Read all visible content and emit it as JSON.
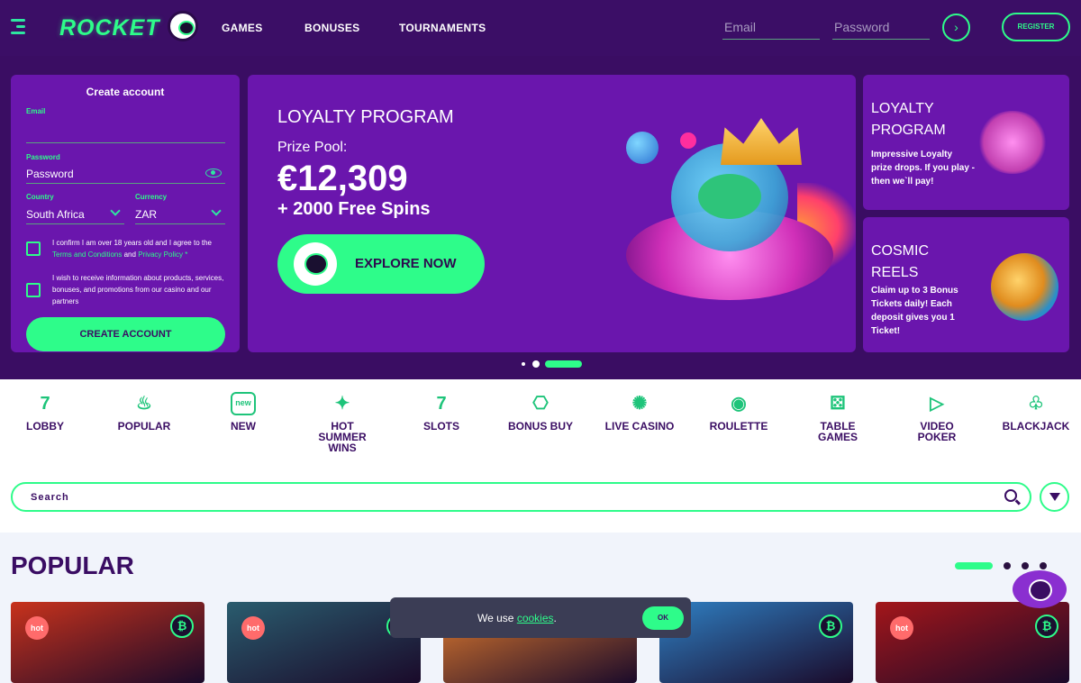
{
  "nav": {
    "logo": "ROCKET",
    "links": [
      "GAMES",
      "BONUSES",
      "TOURNAMENTS"
    ],
    "email_placeholder": "Email",
    "password_placeholder": "Password",
    "go_label": "›",
    "register_label": "REGISTER"
  },
  "signup": {
    "title": "Create account",
    "email_label": "Email",
    "password_label": "Password",
    "password_value": "Password",
    "country_label": "Country",
    "country_value": "South Africa",
    "currency_label": "Currency",
    "currency_value": "ZAR",
    "confirm_text_1": "I confirm I am over 18 years old and I agree to the",
    "terms_link": "Terms and Conditions",
    "and_text": "and",
    "privacy_link": "Privacy Policy",
    "asterisk": "*",
    "marketing_text": "I wish to receive information about products, services, bonuses, and promotions from our casino and our partners",
    "create_button": "CREATE ACCOUNT"
  },
  "hero": {
    "title": "LOYALTY PROGRAM",
    "prize_label": "Prize Pool:",
    "prize_value": "€12,309",
    "spins": "+ 2000 Free Spins",
    "cta": "EXPLORE NOW"
  },
  "promo_cards": [
    {
      "title_1": "LOYALTY",
      "title_2": "PROGRAM",
      "desc": "Impressive Loyalty prize drops. If you play - then we`ll pay!"
    },
    {
      "title_1": "COSMIC",
      "title_2": "REELS",
      "desc": "Claim up to 3 Bonus Tickets daily! Each deposit gives you 1 Ticket!"
    }
  ],
  "carousel": {
    "slide_count": 3,
    "active_index": 2
  },
  "categories": [
    {
      "label": "LOBBY",
      "icon": "lobby-icon",
      "glyph": "7"
    },
    {
      "label": "POPULAR",
      "icon": "flame-icon",
      "glyph": "♨"
    },
    {
      "label": "NEW",
      "icon": "new-badge-icon",
      "glyph": "new"
    },
    {
      "label": "HOT SUMMER WINS",
      "icon": "party-popper-icon",
      "glyph": "✦"
    },
    {
      "label": "SLOTS",
      "icon": "slots-seven-icon",
      "glyph": "7"
    },
    {
      "label": "BONUS BUY",
      "icon": "gift-icon",
      "glyph": "⎔"
    },
    {
      "label": "LIVE CASINO",
      "icon": "chip-icon",
      "glyph": "✺"
    },
    {
      "label": "ROULETTE",
      "icon": "roulette-icon",
      "glyph": "◉"
    },
    {
      "label": "TABLE GAMES",
      "icon": "dice-icon",
      "glyph": "⚄"
    },
    {
      "label": "VIDEO POKER",
      "icon": "play-icon",
      "glyph": "▷"
    },
    {
      "label": "BLACKJACK",
      "icon": "club-icon",
      "glyph": "♧"
    }
  ],
  "search": {
    "placeholder": "Search"
  },
  "popular": {
    "title": "POPULAR",
    "page_count": 4,
    "active_page": 0,
    "games": [
      {
        "badge": "hot",
        "btc": "₿",
        "color": "#c8321c"
      },
      {
        "badge": "hot",
        "btc": "₿",
        "color": "#2a5c6e"
      },
      {
        "badge": "",
        "btc": "",
        "color": "#e07b2e"
      },
      {
        "badge": "",
        "btc": "₿",
        "color": "#2f7fc2"
      },
      {
        "badge": "hot",
        "btc": "₿",
        "color": "#a3161a"
      }
    ]
  },
  "cookie": {
    "text": "We use",
    "link": "cookies",
    "period": ".",
    "ok": "OK"
  },
  "colors": {
    "accent": "#2efc8a",
    "brand_purple": "#6a16ad",
    "dark_purple": "#3a0d63"
  }
}
